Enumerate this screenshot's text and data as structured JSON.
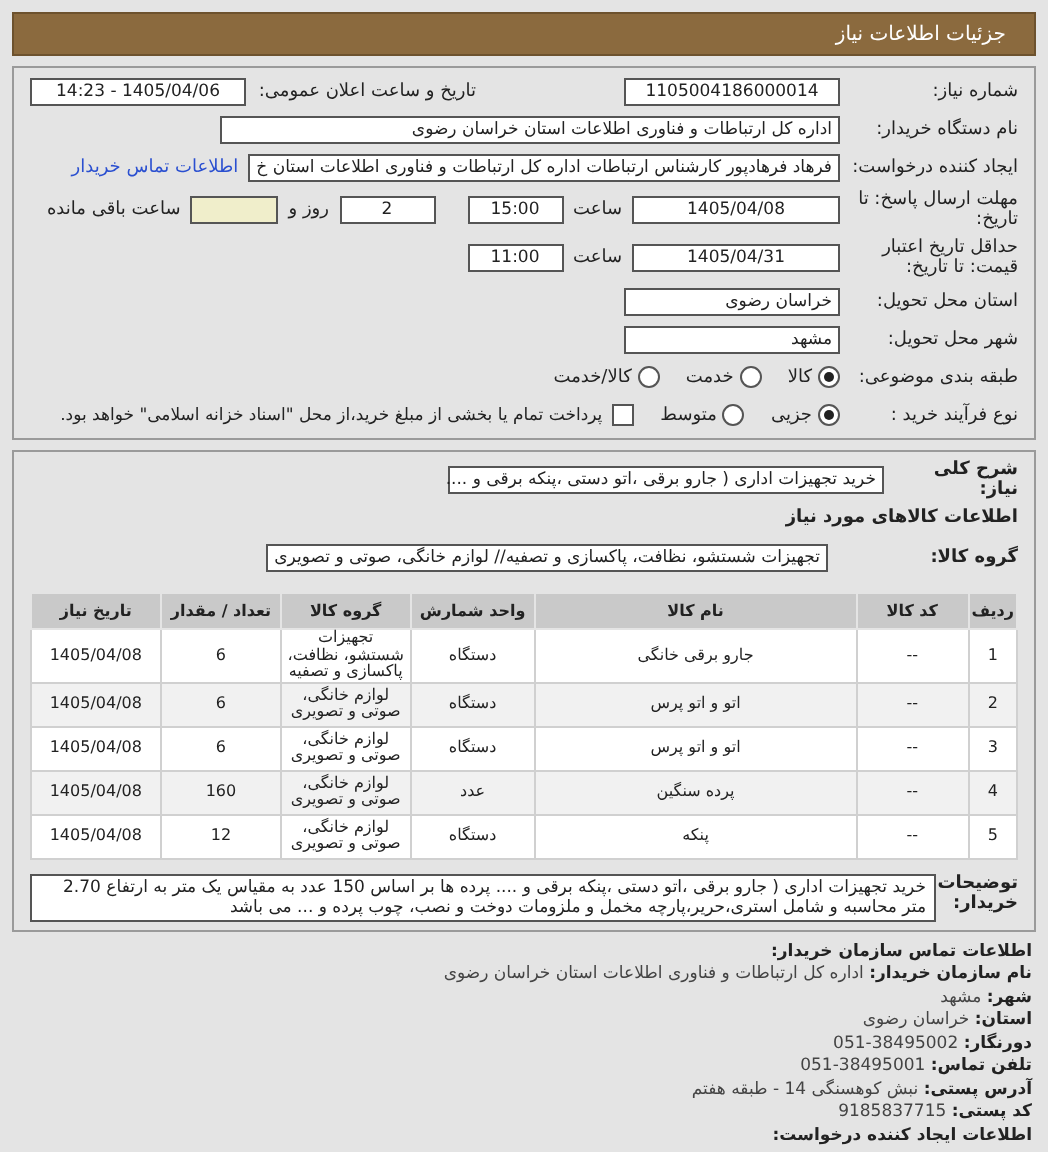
{
  "header": {
    "title": "جزئیات اطلاعات نیاز"
  },
  "need_number": {
    "label": "شماره نیاز:",
    "value": "1105004186000014"
  },
  "announce": {
    "label": "تاریخ و ساعت اعلان عمومی:",
    "value": "1405/04/06 - 14:23"
  },
  "buyer": {
    "label": "نام دستگاه خریدار:",
    "value": "اداره کل ارتباطات و فناوری اطلاعات استان خراسان رضوی"
  },
  "creator": {
    "label": "ایجاد کننده درخواست:",
    "value": "فرهاد فرهادپور کارشناس ارتباطات اداره کل ارتباطات و فناوری اطلاعات استان خ",
    "link": "اطلاعات تماس خریدار"
  },
  "deadline": {
    "label": "مهلت ارسال پاسخ: تا تاریخ:",
    "date": "1405/04/08",
    "time_label": "ساعت",
    "time": "15:00",
    "days": "2",
    "days_label": "روز و",
    "remaining_label": "ساعت باقی مانده"
  },
  "validity": {
    "label": "حداقل تاریخ اعتبار قیمت: تا تاریخ:",
    "date": "1405/04/31",
    "time_label": "ساعت",
    "time": "11:00"
  },
  "province": {
    "label": "استان محل تحویل:",
    "value": "خراسان رضوی"
  },
  "city": {
    "label": "شهر محل تحویل:",
    "value": "مشهد"
  },
  "category": {
    "label": "طبقه بندی موضوعی:",
    "options": [
      {
        "label": "کالا",
        "selected": true
      },
      {
        "label": "خدمت",
        "selected": false
      },
      {
        "label": "کالا/خدمت",
        "selected": false
      }
    ]
  },
  "process": {
    "label": "نوع فرآیند خرید :",
    "options": [
      {
        "label": "جزیی",
        "selected": true
      },
      {
        "label": "متوسط",
        "selected": false
      }
    ],
    "payment": {
      "label": "پرداخت تمام یا بخشی از مبلغ خرید،از محل \"اسناد خزانه اسلامی\" خواهد بود.",
      "checked": false
    }
  },
  "summary": {
    "label": "شرح کلی نیاز:",
    "value": "خرید تجهیزات اداری ( جارو برقی ،اتو دستی ،پنکه برقی و ...."
  },
  "goods_heading": "اطلاعات کالاهای مورد نیاز",
  "goods_group": {
    "label": "گروه کالا:",
    "value": "تجهیزات شستشو، نظافت، پاکسازی و تصفیه// لوازم خانگی، صوتی و تصویری"
  },
  "table": {
    "columns": [
      "ردیف",
      "کد کالا",
      "نام کالا",
      "واحد شمارش",
      "گروه کالا",
      "تعداد / مقدار",
      "تاریخ نیاز"
    ],
    "rows": [
      [
        "1",
        "--",
        "جارو برقی خانگی",
        "دستگاه",
        "تجهیزات شستشو، نظافت، پاکسازی و تصفیه",
        "6",
        "1405/04/08"
      ],
      [
        "2",
        "--",
        "اتو و اتو پرس",
        "دستگاه",
        "لوازم خانگی، صوتی و تصویری",
        "6",
        "1405/04/08"
      ],
      [
        "3",
        "--",
        "اتو و اتو پرس",
        "دستگاه",
        "لوازم خانگی، صوتی و تصویری",
        "6",
        "1405/04/08"
      ],
      [
        "4",
        "--",
        "پرده سنگین",
        "عدد",
        "لوازم خانگی، صوتی و تصویری",
        "160",
        "1405/04/08"
      ],
      [
        "5",
        "--",
        "پنکه",
        "دستگاه",
        "لوازم خانگی، صوتی و تصویری",
        "12",
        "1405/04/08"
      ]
    ]
  },
  "notes": {
    "label": "توضیحات خریدار:",
    "value": "خرید تجهیزات اداری ( جارو برقی ،اتو دستی ،پنکه برقی و .... پرده ها بر اساس 150 عدد به مقیاس یک متر به ارتفاع 2.70 متر محاسبه و شامل استری،حریر،پارچه مخمل و ملزومات دوخت و نصب، چوب پرده و ... می باشد"
  },
  "contact": {
    "heading": "اطلاعات تماس سازمان خریدار:",
    "items": [
      {
        "label": "نام سازمان خریدار:",
        "value": "اداره کل ارتباطات و فناوری اطلاعات استان خراسان رضوی"
      },
      {
        "label": "شهر:",
        "value": "مشهد"
      },
      {
        "label": "استان:",
        "value": "خراسان رضوی"
      },
      {
        "label": "دورنگار:",
        "value": "38495002-051"
      },
      {
        "label": "تلفن تماس:",
        "value": "38495001-051"
      },
      {
        "label": "آدرس پستی:",
        "value": "نبش کوهسنگی 14 - طبقه هفتم"
      },
      {
        "label": "کد پستی:",
        "value": "9185837715"
      }
    ],
    "creator_heading": "اطلاعات ایجاد کننده درخواست:"
  }
}
